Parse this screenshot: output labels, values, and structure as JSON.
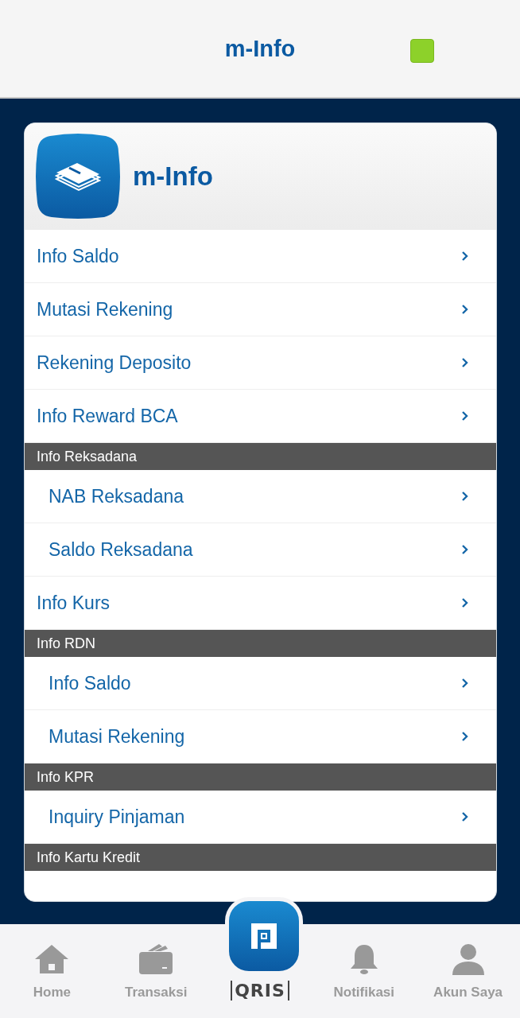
{
  "header": {
    "title": "m-Info"
  },
  "card": {
    "title": "m-Info"
  },
  "menu": [
    {
      "kind": "item",
      "label": "Info Saldo"
    },
    {
      "kind": "item",
      "label": "Mutasi Rekening"
    },
    {
      "kind": "item",
      "label": "Rekening Deposito"
    },
    {
      "kind": "item",
      "label": "Info Reward BCA"
    },
    {
      "kind": "section",
      "label": "Info Reksadana"
    },
    {
      "kind": "subitem",
      "label": "NAB Reksadana"
    },
    {
      "kind": "subitem",
      "label": "Saldo Reksadana"
    },
    {
      "kind": "item",
      "label": "Info Kurs"
    },
    {
      "kind": "section",
      "label": "Info RDN"
    },
    {
      "kind": "subitem",
      "label": "Info Saldo"
    },
    {
      "kind": "subitem",
      "label": "Mutasi Rekening"
    },
    {
      "kind": "section",
      "label": "Info KPR"
    },
    {
      "kind": "subitem",
      "label": "Inquiry Pinjaman"
    },
    {
      "kind": "section",
      "label": "Info Kartu Kredit"
    }
  ],
  "bottom_nav": [
    {
      "kind": "home",
      "label": "Home"
    },
    {
      "kind": "wallet",
      "label": "Transaksi"
    },
    {
      "kind": "qris",
      "label": "QRIS"
    },
    {
      "kind": "bell",
      "label": "Notifikasi"
    },
    {
      "kind": "user",
      "label": "Akun Saya"
    }
  ]
}
